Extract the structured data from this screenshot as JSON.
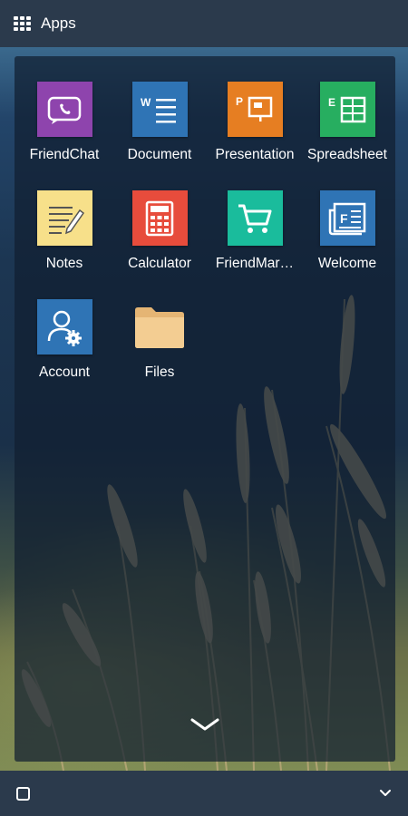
{
  "topbar": {
    "title": "Apps",
    "icon": "apps-grid-icon"
  },
  "apps": [
    {
      "label": "FriendChat",
      "icon": "friendchat-icon",
      "color": "#8e44ad"
    },
    {
      "label": "Document",
      "icon": "document-icon",
      "color": "#2f74b5"
    },
    {
      "label": "Presentation",
      "icon": "presentation-icon",
      "color": "#e67e22"
    },
    {
      "label": "Spreadsheet",
      "icon": "spreadsheet-icon",
      "color": "#27ae60"
    },
    {
      "label": "Notes",
      "icon": "notes-icon",
      "color": "#f7e08a"
    },
    {
      "label": "Calculator",
      "icon": "calculator-icon",
      "color": "#e74c3c"
    },
    {
      "label": "FriendMar…",
      "icon": "friendmarket-icon",
      "color": "#1abc9c"
    },
    {
      "label": "Welcome",
      "icon": "welcome-icon",
      "color": "#2f74b5"
    },
    {
      "label": "Account",
      "icon": "account-icon",
      "color": "#2f74b5"
    },
    {
      "label": "Files",
      "icon": "folder-icon",
      "color": "#f3c98b"
    }
  ],
  "panel": {
    "collapse_icon": "chevron-down-icon"
  },
  "bottombar": {
    "left_icon": "square-icon",
    "right_icon": "chevron-down-icon"
  }
}
